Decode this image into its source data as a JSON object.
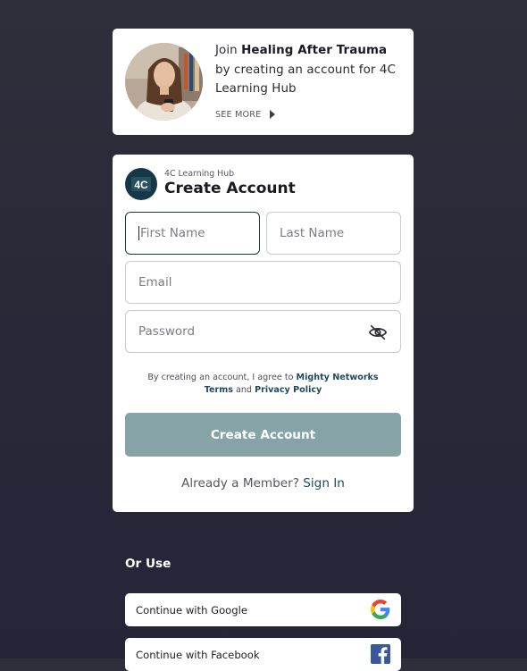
{
  "promo": {
    "join_prefix": "Join",
    "network_bold": "Healing After Trauma",
    "join_suffix": "by creating an account for 4C Learning Hub",
    "see_more": "SEE MORE"
  },
  "form": {
    "logo_text": "4C",
    "network_name": "4C Learning Hub",
    "title": "Create Account",
    "first_name_placeholder": "First Name",
    "last_name_placeholder": "Last Name",
    "email_placeholder": "Email",
    "password_placeholder": "Password",
    "consent_prefix": "By creating an account, I agree to",
    "consent_link_1a": "Mighty Networks",
    "consent_link_1b": "Terms",
    "consent_and": "and",
    "consent_link_2": "Privacy Policy",
    "submit_label": "Create Account",
    "member_prompt": "Already a Member?",
    "signin_label": "Sign In"
  },
  "social": {
    "heading": "Or Use",
    "google_label": "Continue with Google",
    "facebook_label": "Continue with Facebook"
  },
  "colors": {
    "background": "#2a2a38",
    "accent": "#1e4a5c",
    "button_disabled": "#86a4a8",
    "logo_bg": "#163746"
  },
  "icons": [
    "play-caret-icon",
    "eye-off-icon",
    "google-icon",
    "facebook-icon"
  ]
}
